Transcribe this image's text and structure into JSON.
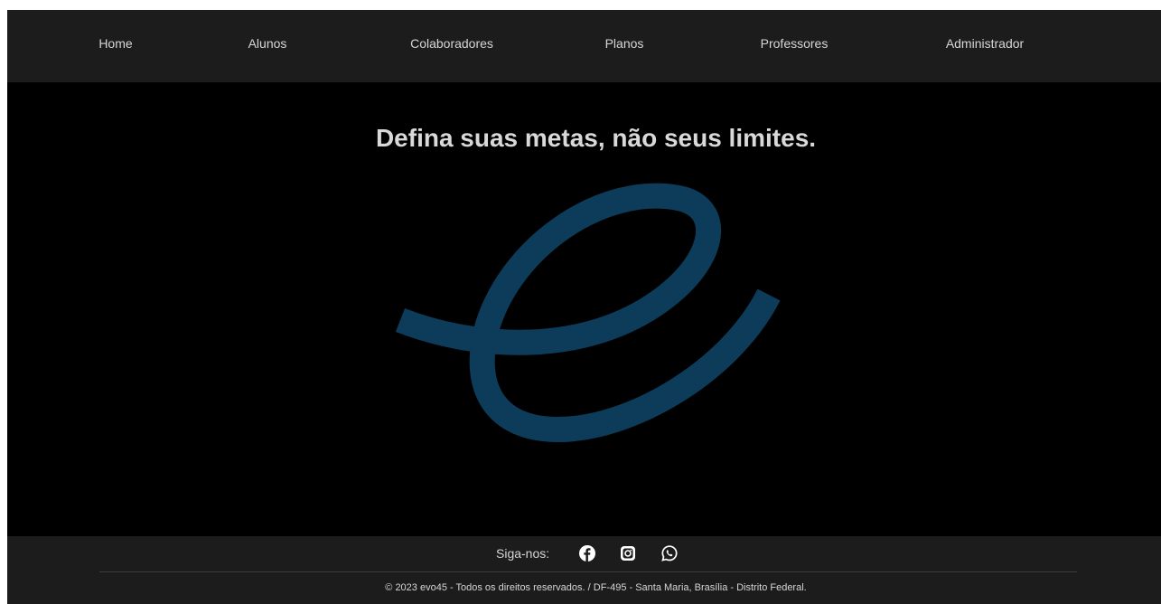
{
  "nav": {
    "items": [
      {
        "label": "Home"
      },
      {
        "label": "Alunos"
      },
      {
        "label": "Colaboradores"
      },
      {
        "label": "Planos"
      },
      {
        "label": "Professores"
      },
      {
        "label": "Administrador"
      }
    ]
  },
  "hero": {
    "headline": "Defina suas metas, não seus limites.",
    "logo_icon": "evo45-e-logo",
    "logo_color": "#0c3c59"
  },
  "footer": {
    "follow_label": "Siga-nos:",
    "social_icons": [
      "facebook-icon",
      "instagram-icon",
      "whatsapp-icon"
    ],
    "copyright": "© 2023 evo45 - Todos os direitos reservados.  /  DF-495 - Santa Maria, Brasília - Distrito Federal."
  },
  "colors": {
    "navbar_bg": "#1c1c1c",
    "page_bg": "#000000",
    "text": "#d6d6d6"
  }
}
